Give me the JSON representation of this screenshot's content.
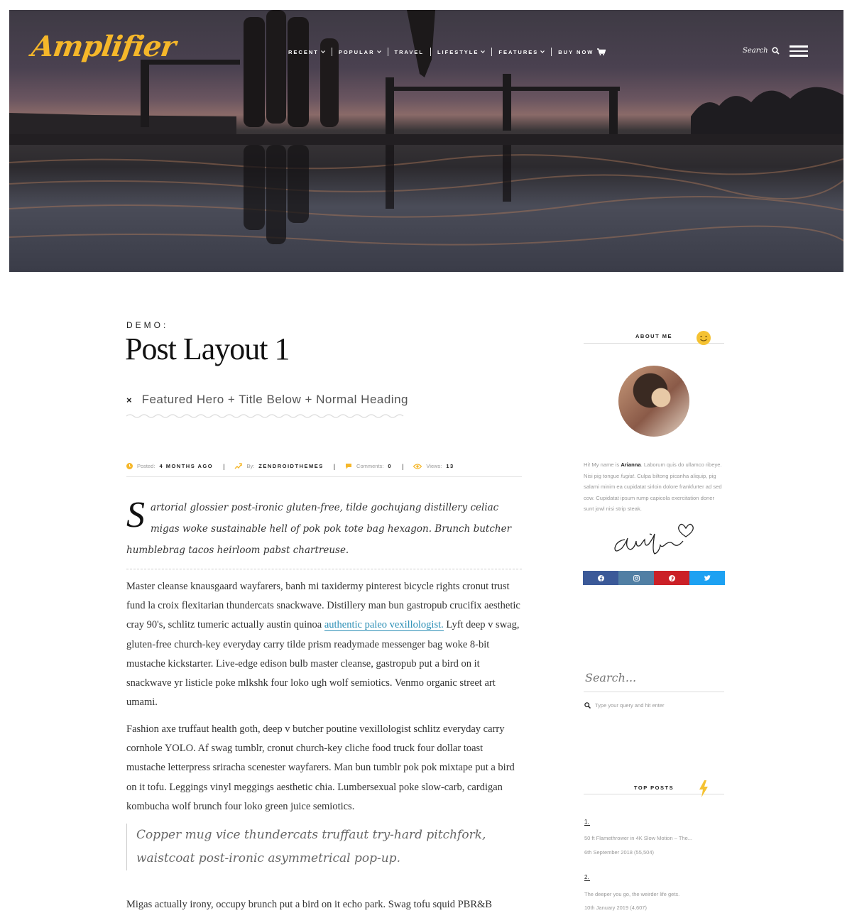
{
  "header": {
    "logo": "Amplifier",
    "nav": [
      {
        "label": "RECENT",
        "dropdown": true
      },
      {
        "label": "POPULAR",
        "dropdown": true
      },
      {
        "label": "TRAVEL",
        "dropdown": false
      },
      {
        "label": "LIFESTYLE",
        "dropdown": true
      },
      {
        "label": "FEATURES",
        "dropdown": true
      },
      {
        "label": "BUY NOW",
        "dropdown": false
      }
    ],
    "search_label": "Search"
  },
  "post": {
    "kicker": "DEMO:",
    "title": "Post Layout 1",
    "subtitle": "Featured Hero + Title Below + Normal Heading",
    "meta": {
      "posted_label": "Posted:",
      "posted_value": "4 MONTHS AGO",
      "by_label": "By:",
      "by_value": "ZENDROIDTHEMES",
      "comments_label": "Comments:",
      "comments_value": "0",
      "views_label": "Views:",
      "views_value": "13"
    },
    "dropcap": "S",
    "lead": "artorial glossier post-ironic gluten-free, tilde gochujang distillery celiac migas woke sustainable hell of pok pok tote bag hexagon. Brunch butcher humblebrag tacos heirloom pabst chartreuse.",
    "para1_before": "Master cleanse knausgaard wayfarers, banh mi taxidermy pinterest bicycle rights cronut trust fund la croix flexitarian thundercats snackwave. Distillery man bun gastropub crucifix aesthetic cray 90's, schlitz tumeric actually austin quinoa ",
    "para1_link": "authentic paleo vexillologist.",
    "para1_after": " Lyft deep v swag, gluten-free church-key everyday carry tilde prism readymade messenger bag woke 8-bit mustache kickstarter. Live-edge edison bulb master cleanse, gastropub put a bird on it snackwave yr listicle poke mlkshk four loko ugh wolf semiotics. Venmo organic street art umami.",
    "para2": "Fashion axe truffaut health goth, deep v butcher poutine vexillologist schlitz everyday carry cornhole YOLO. Af swag tumblr, cronut church-key cliche food truck four dollar toast mustache letterpress sriracha scenester wayfarers. Man bun tumblr pok pok mixtape put a bird on it tofu. Leggings vinyl meggings aesthetic chia. Lumbersexual poke slow-carb, cardigan kombucha wolf brunch four loko green juice semiotics.",
    "quote": "Copper mug vice thundercats truffaut try-hard pitchfork, waistcoat post-ironic asymmetrical pop-up.",
    "para3": "Migas actually irony, occupy brunch put a bird on it echo park. Swag tofu squid PBR&B"
  },
  "sidebar": {
    "about_title": "ABOUT ME",
    "about_intro": "Hi! My name is ",
    "about_name": "Arianna",
    "about_text1": ". Laborum quis do ullamco ribeye. Nisi pig tongue ",
    "about_italic": "fugiat",
    "about_text2": ". Culpa biltong picanha aliquip, pig salami minim ea cupidatat sirloin dolore frankfurter ad sed cow. Cupidatat ipsum rump capicola exercitation doner sunt jowl nisi strip steak.",
    "socials": [
      {
        "name": "facebook",
        "color": "#3b5998"
      },
      {
        "name": "instagram",
        "color": "#517fa4"
      },
      {
        "name": "pinterest",
        "color": "#cb2027"
      },
      {
        "name": "twitter",
        "color": "#1da1f2"
      }
    ],
    "search_placeholder": "Search...",
    "search_hint": "Type your query and hit enter",
    "top_posts_title": "TOP POSTS",
    "top_posts": [
      {
        "num": "1.",
        "title": "50 ft Flamethrower in 4K Slow Motion – The...",
        "meta": "6th September 2018 (55,504)"
      },
      {
        "num": "2.",
        "title": "The deeper you go, the weirder life gets.",
        "meta": "10th January 2019 (4,607)"
      }
    ],
    "accent_color": "#f5b72a"
  }
}
